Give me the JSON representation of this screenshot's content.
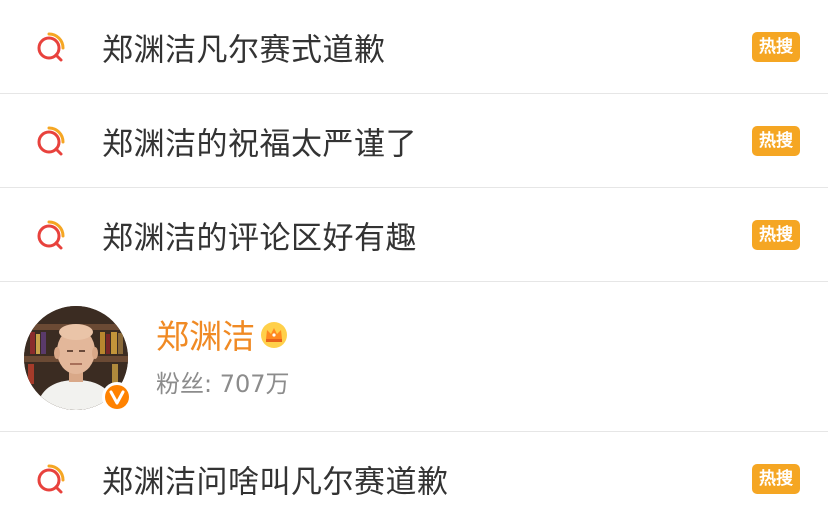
{
  "results": [
    {
      "type": "query",
      "text": "郑渊洁凡尔赛式道歉",
      "badge": "热搜"
    },
    {
      "type": "query",
      "text": "郑渊洁的祝福太严谨了",
      "badge": "热搜"
    },
    {
      "type": "query",
      "text": "郑渊洁的评论区好有趣",
      "badge": "热搜"
    },
    {
      "type": "user",
      "name": "郑渊洁",
      "followers": "粉丝: 707万"
    },
    {
      "type": "query",
      "text": "郑渊洁问啥叫凡尔赛道歉",
      "badge": "热搜"
    }
  ],
  "colors": {
    "badge_bg": "#f5a623",
    "username": "#f08a24",
    "search_icon_ring": "#e8423d",
    "search_icon_arc": "#f5a623",
    "verified": "#ff8200"
  },
  "icons": {
    "search": "search-icon",
    "crown": "crown-icon",
    "verified": "verified-icon"
  }
}
